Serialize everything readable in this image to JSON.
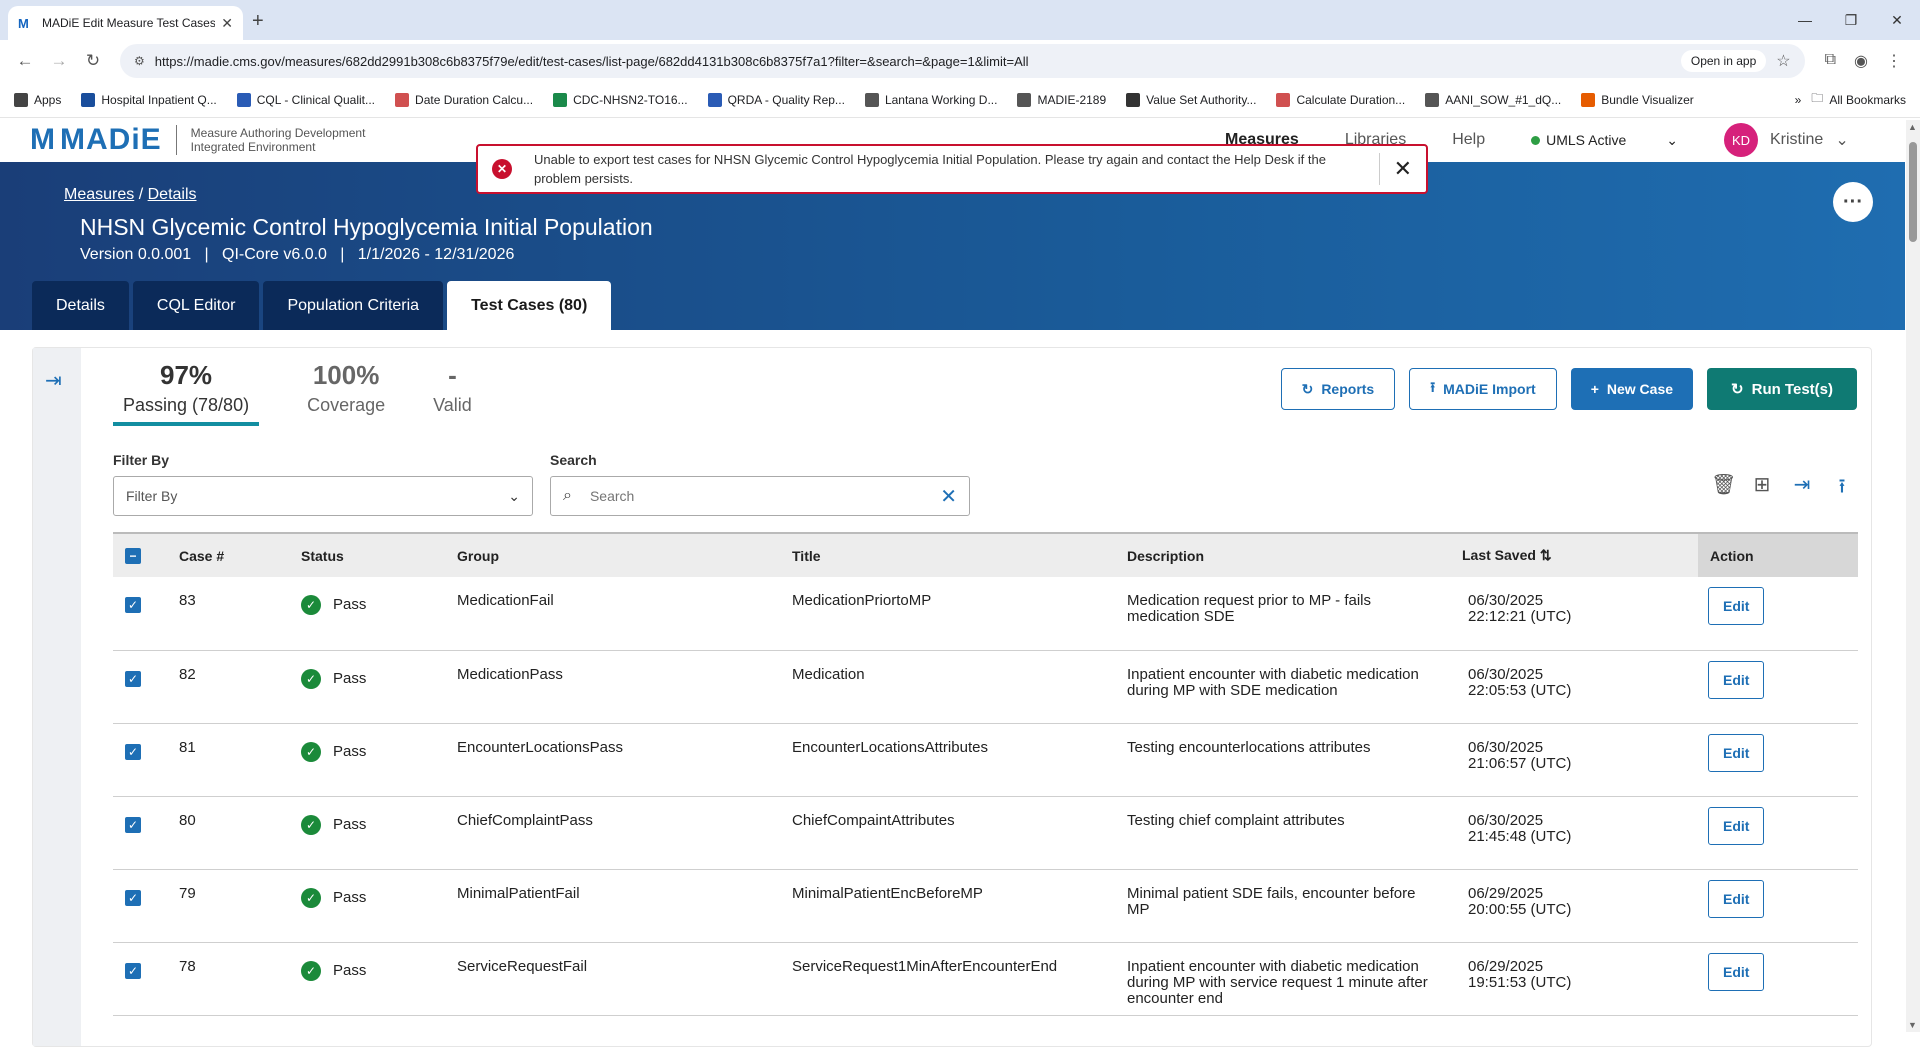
{
  "browser": {
    "tab_title": "MADiE Edit Measure Test Cases",
    "url": "https://madie.cms.gov/measures/682dd2991b308c6b8375f79e/edit/test-cases/list-page/682dd4131b308c6b8375f7a1?filter=&search=&page=1&limit=All",
    "open_in_app": "Open in app",
    "bookmarks": [
      {
        "label": "Apps",
        "icon": "apps-grid-icon",
        "color": "#444444"
      },
      {
        "label": "Hospital Inpatient Q...",
        "icon": "qnet-icon",
        "color": "#1a4e9c"
      },
      {
        "label": "CQL - Clinical Qualit...",
        "icon": "rc-icon",
        "color": "#2a5bb5"
      },
      {
        "label": "Date Duration Calcu...",
        "icon": "dots-icon",
        "color": "#d05050"
      },
      {
        "label": "CDC-NHSN2-TO16...",
        "icon": "dollar-icon",
        "color": "#1a8a4a"
      },
      {
        "label": "QRDA - Quality Rep...",
        "icon": "rc-icon",
        "color": "#2a5bb5"
      },
      {
        "label": "Lantana Working D...",
        "icon": "globe-icon",
        "color": "#555555"
      },
      {
        "label": "MADIE-2189",
        "icon": "globe-icon",
        "color": "#555555"
      },
      {
        "label": "Value Set Authority...",
        "icon": "vsac-icon",
        "color": "#333333"
      },
      {
        "label": "Calculate Duration...",
        "icon": "dots-icon",
        "color": "#d05050"
      },
      {
        "label": "AANI_SOW_#1_dQ...",
        "icon": "globe-icon",
        "color": "#555555"
      },
      {
        "label": "Bundle Visualizer",
        "icon": "flame-icon",
        "color": "#e65c00"
      }
    ],
    "all_bookmarks": "All Bookmarks"
  },
  "app": {
    "logo_word": "MADiE",
    "tagline_1": "Measure Authoring Development",
    "tagline_2": "Integrated Environment",
    "nav": [
      "Measures",
      "Libraries",
      "Help"
    ],
    "umls_status": "UMLS Active",
    "user_initials": "KD",
    "user_name": "Kristine"
  },
  "error_toast": {
    "message": "Unable to export test cases for NHSN Glycemic Control Hypoglycemia Initial Population. Please try again and contact the Help Desk if the problem persists."
  },
  "breadcrumb": {
    "measures": "Measures",
    "sep": "/",
    "details": "Details"
  },
  "measure": {
    "title": "NHSN Glycemic Control Hypoglycemia Initial Population",
    "meta": "Version 0.0.001   |   QI-Core v6.0.0   |   1/1/2026 - 12/31/2026"
  },
  "tabs": [
    "Details",
    "CQL Editor",
    "Population Criteria",
    "Test Cases (80)"
  ],
  "stats": {
    "passing_value": "97%",
    "passing_label": "Passing (78/80)",
    "coverage_value": "100%",
    "coverage_label": "Coverage",
    "valid_value": "-",
    "valid_label": "Valid"
  },
  "buttons": {
    "reports": "Reports",
    "import": "MADiE Import",
    "new_case": "New Case",
    "run_tests": "Run Test(s)"
  },
  "filter": {
    "label": "Filter By",
    "placeholder": "Filter By"
  },
  "search": {
    "label": "Search",
    "placeholder": "Search",
    "value": ""
  },
  "table": {
    "headers": [
      "Case #",
      "Status",
      "Group",
      "Title",
      "Description",
      "Last Saved",
      "Action"
    ],
    "rows": [
      {
        "case": "83",
        "status": "Pass",
        "group": "MedicationFail",
        "title": "MedicationPriortoMP",
        "desc": "Medication request prior to MP - fails medication SDE",
        "date": "06/30/2025",
        "time": "22:12:21 (UTC)",
        "action": "Edit"
      },
      {
        "case": "82",
        "status": "Pass",
        "group": "MedicationPass",
        "title": "Medication",
        "desc": "Inpatient encounter with diabetic medication during MP with SDE medication",
        "date": "06/30/2025",
        "time": "22:05:53 (UTC)",
        "action": "Edit"
      },
      {
        "case": "81",
        "status": "Pass",
        "group": "EncounterLocationsPass",
        "title": "EncounterLocationsAttributes",
        "desc": "Testing encounterlocations attributes",
        "date": "06/30/2025",
        "time": "21:06:57 (UTC)",
        "action": "Edit"
      },
      {
        "case": "80",
        "status": "Pass",
        "group": "ChiefComplaintPass",
        "title": "ChiefCompaintAttributes",
        "desc": "Testing chief complaint attributes",
        "date": "06/30/2025",
        "time": "21:45:48 (UTC)",
        "action": "Edit"
      },
      {
        "case": "79",
        "status": "Pass",
        "group": "MinimalPatientFail",
        "title": "MinimalPatientEncBeforeMP",
        "desc": "Minimal patient SDE fails, encounter before MP",
        "date": "06/29/2025",
        "time": "20:00:55 (UTC)",
        "action": "Edit"
      },
      {
        "case": "78",
        "status": "Pass",
        "group": "ServiceRequestFail",
        "title": "ServiceRequest1MinAfterEncounterEnd",
        "desc": "Inpatient encounter with diabetic medication during MP with service request 1 minute after encounter end",
        "date": "06/29/2025",
        "time": "19:51:53 (UTC)",
        "action": "Edit"
      }
    ]
  },
  "colors": {
    "brand": "#1e6fb5",
    "teal": "#0f7a73",
    "error": "#c8102e",
    "pass": "#1b8a3a",
    "banner": "#1a4e8c"
  }
}
